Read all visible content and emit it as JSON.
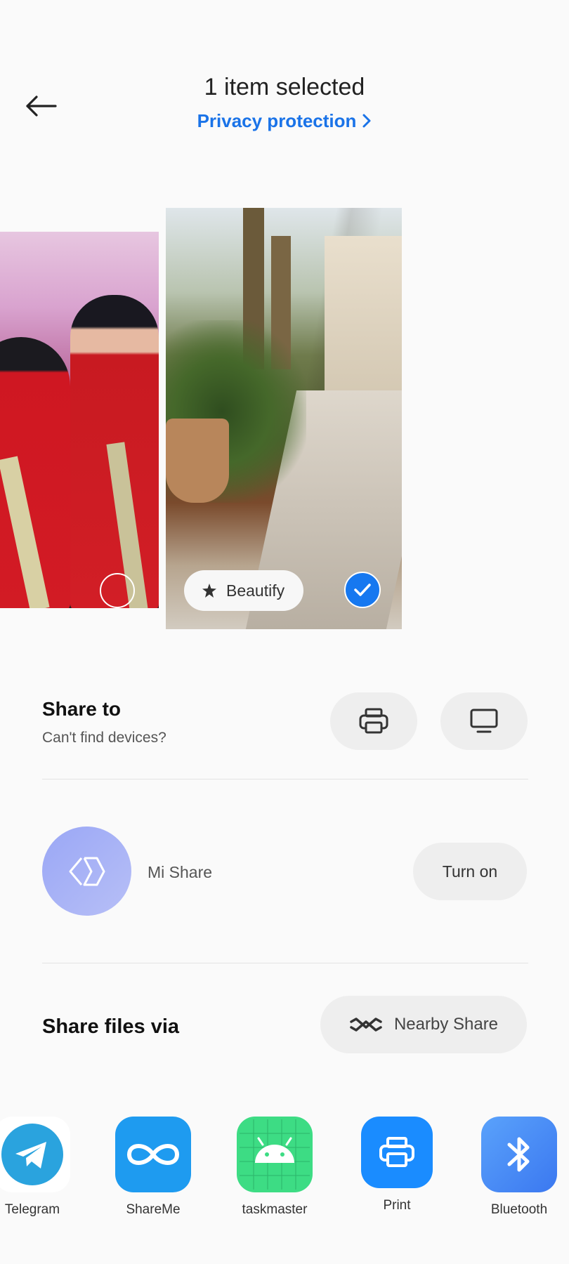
{
  "header": {
    "title": "1 item selected",
    "privacy_link": "Privacy protection"
  },
  "gallery": {
    "beautify_label": "Beautify",
    "selected_count": 1
  },
  "share_to": {
    "title": "Share to",
    "subtitle": "Can't find devices?",
    "devices": [
      {
        "icon": "printer-icon"
      },
      {
        "icon": "tv-icon"
      }
    ]
  },
  "mi_share": {
    "label": "Mi Share",
    "button": "Turn on"
  },
  "share_files": {
    "title": "Share files via",
    "nearby_label": "Nearby Share"
  },
  "apps": [
    {
      "label": "Telegram",
      "icon": "telegram-icon",
      "color": "#2aa3de"
    },
    {
      "label": "ShareMe",
      "icon": "shareme-icon",
      "color": "#1e9bf0"
    },
    {
      "label": "taskmaster",
      "icon": "android-icon",
      "color": "#3ddc84"
    },
    {
      "label": "Print",
      "icon": "print-icon",
      "color": "#1a8cff"
    },
    {
      "label": "Bluetooth",
      "icon": "bluetooth-icon",
      "color": "#3b86f5"
    }
  ]
}
